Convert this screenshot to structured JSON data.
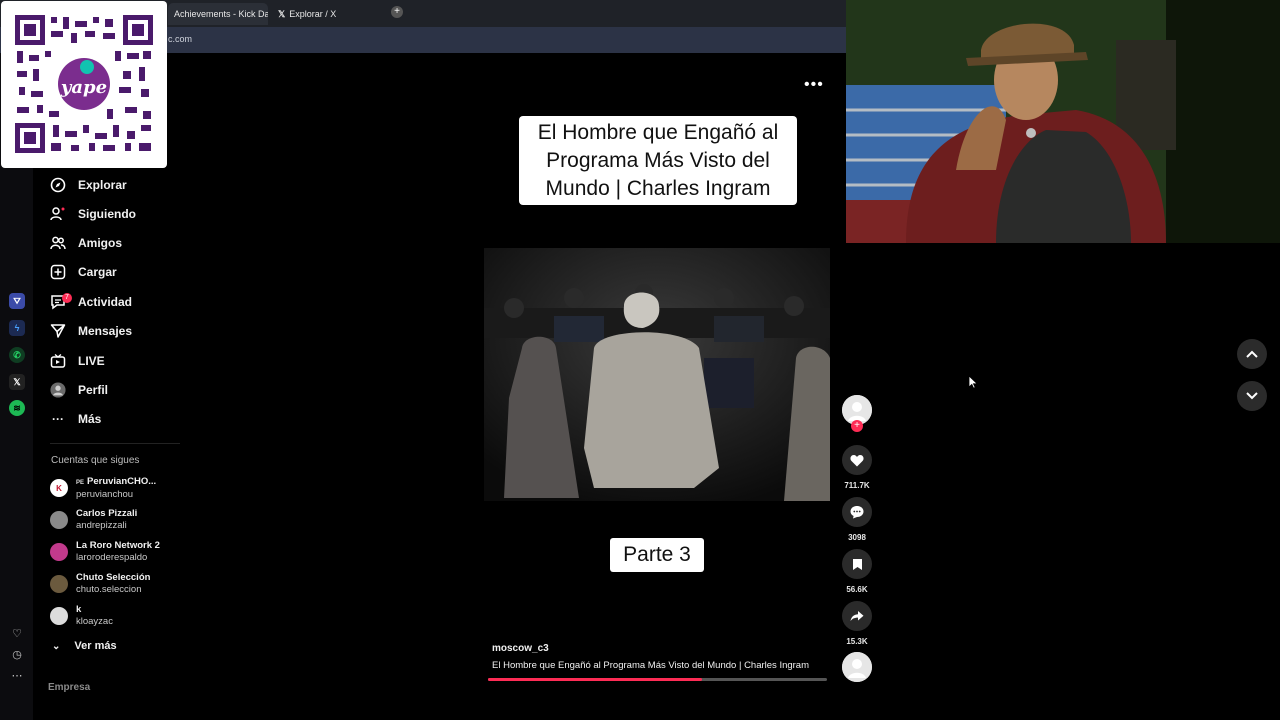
{
  "browser": {
    "tabs": [
      {
        "label": "Achievements - Kick Dash",
        "active": true
      },
      {
        "label": "Explorar / X",
        "active": false
      }
    ],
    "url_fragment": "c.com"
  },
  "qr": {
    "brand": "yape"
  },
  "left_bar_icons": [
    "kick-icon",
    "messenger-icon",
    "whatsapp-icon",
    "x-icon",
    "spotify-icon"
  ],
  "sidebar": {
    "nav": [
      {
        "label": "Explorar",
        "icon": "compass-icon"
      },
      {
        "label": "Siguiendo",
        "icon": "following-icon"
      },
      {
        "label": "Amigos",
        "icon": "friends-icon"
      },
      {
        "label": "Cargar",
        "icon": "upload-icon"
      },
      {
        "label": "Actividad",
        "icon": "activity-icon",
        "badge": "7"
      },
      {
        "label": "Mensajes",
        "icon": "messages-icon"
      },
      {
        "label": "LIVE",
        "icon": "live-icon"
      },
      {
        "label": "Perfil",
        "icon": "profile-icon"
      },
      {
        "label": "Más",
        "icon": "more-icon"
      }
    ],
    "following_title": "Cuentas que sigues",
    "accounts": [
      {
        "prefix": "PE",
        "name": "PeruvianCHO...",
        "handle": "peruvianchou"
      },
      {
        "prefix": "",
        "name": "Carlos Pizzali",
        "handle": "andrepizzali"
      },
      {
        "prefix": "",
        "name": "La Roro Network 2",
        "handle": "laroroderespaldo"
      },
      {
        "prefix": "",
        "name": "Chuto Selección",
        "handle": "chuto.seleccion"
      },
      {
        "prefix": "",
        "name": "k",
        "handle": "kloayzac"
      }
    ],
    "see_more": "Ver más",
    "footer": "Empresa"
  },
  "video": {
    "title_card": "El Hombre que Engañó al Programa Más Visto del Mundo | Charles Ingram",
    "part_label": "Parte 3",
    "author": "moscow_c3",
    "caption": "El Hombre que Engañó al Programa Más Visto del Mundo | Charles Ingram",
    "progress": 0.63
  },
  "actions": {
    "likes": "711.7K",
    "comments": "3098",
    "saves": "56.6K",
    "shares": "15.3K"
  },
  "colors": {
    "accent": "#fe2c55",
    "background": "#000000"
  }
}
